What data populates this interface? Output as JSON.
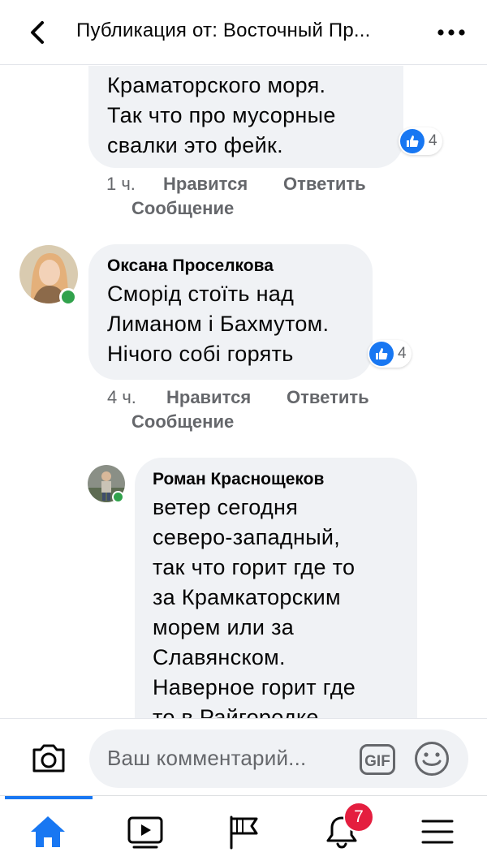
{
  "header": {
    "title": "Публикация от: Восточный Пр...",
    "back_icon": "chevron-left-icon",
    "more_icon": "more-dots-icon"
  },
  "comments": [
    {
      "text_lines": [
        "Краматорского моря.",
        "Так что про мусорные",
        "свалки это фейк."
      ],
      "reactions": "4",
      "time": "1 ч.",
      "like_label": "Нравится",
      "reply_label": "Ответить",
      "message_label": "Сообщение"
    },
    {
      "author": "Оксана Проселкова",
      "text_lines": [
        "Сморід стоїть над",
        "Лиманом і Бахмутом.",
        "Нічого собі горять"
      ],
      "reactions": "4",
      "time": "4 ч.",
      "like_label": "Нравится",
      "reply_label": "Ответить",
      "message_label": "Сообщение"
    },
    {
      "author": "Роман Краснощеков",
      "text_lines": [
        "ветер сегодня",
        "северо-западный,",
        "так что горит где то",
        "за Крамкаторским",
        "морем или за",
        "Славянском.",
        "Наверное горит где",
        "то в Райгородке"
      ]
    }
  ],
  "composer": {
    "placeholder": "Ваш комментарий...",
    "gif_label": "GIF",
    "camera_icon": "camera-icon",
    "emoji_icon": "emoji-icon"
  },
  "tabbar": {
    "notifications_badge": "7",
    "tabs": [
      "home-icon",
      "video-icon",
      "pages-flag-icon",
      "bell-icon",
      "menu-icon"
    ],
    "accent": "#1877f2"
  },
  "colors": {
    "like_blue": "#1877f2",
    "online_green": "#31a24c",
    "bubble_bg": "#f0f2f5",
    "badge_red": "#e41e3f"
  }
}
